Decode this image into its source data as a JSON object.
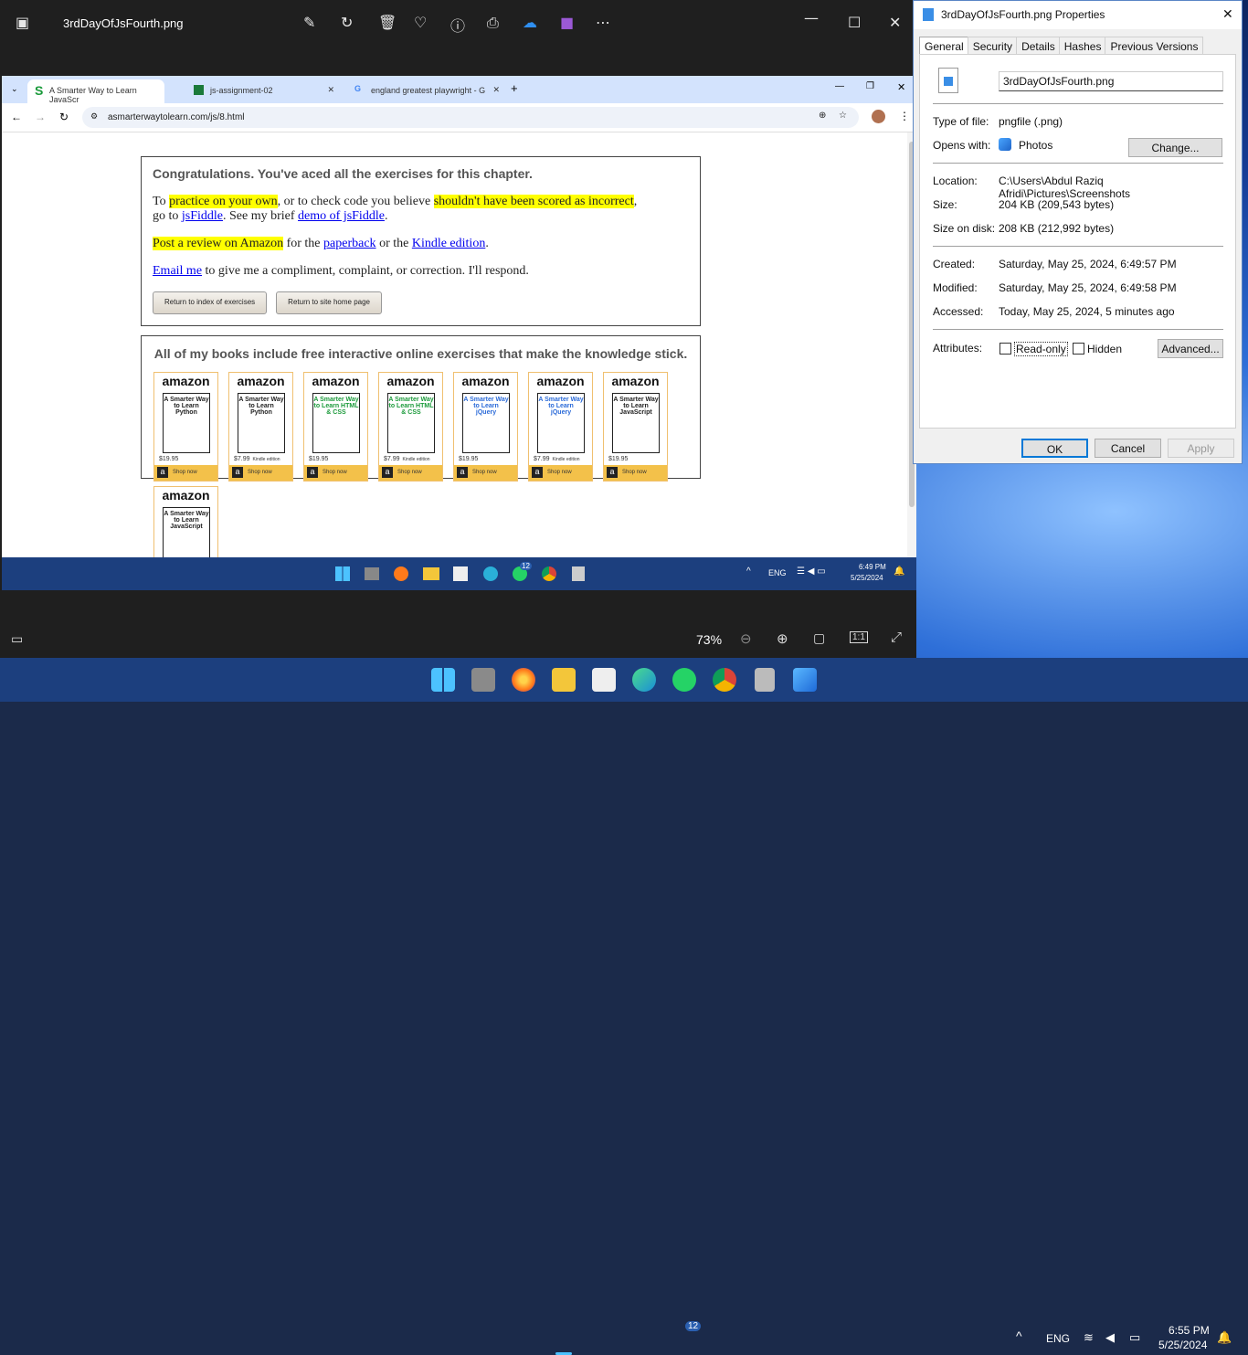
{
  "photos": {
    "filename": "3rdDayOfJsFourth.png",
    "zoom": "73%"
  },
  "browser": {
    "tabs": [
      {
        "label": "A Smarter Way to Learn JavaScr"
      },
      {
        "label": "js-assignment-02"
      },
      {
        "label": "england greatest playwright - G"
      }
    ],
    "url": "asmarterwaytolearn.com/js/8.html"
  },
  "page": {
    "congrats": "Congratulations. You've aced all the exercises for this chapter.",
    "p1_a": "To ",
    "p1_hl1": "practice on your own",
    "p1_b": ", or to check code you believe ",
    "p1_hl2": "shouldn't have been scored as incorrect",
    "p1_c": ",",
    "p1_d": "go to ",
    "p1_jsfiddle": "jsFiddle",
    "p1_e": ". See my brief ",
    "p1_demo": "demo of jsFiddle",
    "p1_f": ".",
    "p2_hl": "Post a review on Amazon",
    "p2_a": " for the ",
    "p2_paperback": "paperback",
    "p2_b": " or the ",
    "p2_kindle": "Kindle edition",
    "p2_c": ".",
    "p3_email": "Email me",
    "p3_a": " to give me a compliment, complaint, or correction. I'll respond.",
    "btn_index": "Return to index of exercises",
    "btn_home": "Return to site home page",
    "books_heading": "All of my books include free interactive online exercises that make the knowledge stick.",
    "amazon": "amazon",
    "shop": "Shop now",
    "books": [
      {
        "title": "A Smarter Way to Learn Python",
        "price": "$19.95",
        "kindle": "",
        "color": "#222"
      },
      {
        "title": "A Smarter Way to Learn Python",
        "price": "$7.99",
        "kindle": "Kindle edition",
        "color": "#222"
      },
      {
        "title": "A Smarter Way to Learn HTML & CSS",
        "price": "$19.95",
        "kindle": "",
        "color": "#1a9a3a"
      },
      {
        "title": "A Smarter Way to Learn HTML & CSS",
        "price": "$7.99",
        "kindle": "Kindle edition",
        "color": "#1a9a3a"
      },
      {
        "title": "A Smarter Way to Learn jQuery",
        "price": "$19.95",
        "kindle": "",
        "color": "#2a6ad8"
      },
      {
        "title": "A Smarter Way to Learn jQuery",
        "price": "$7.99",
        "kindle": "Kindle edition",
        "color": "#2a6ad8"
      },
      {
        "title": "A Smarter Way to Learn JavaScript",
        "price": "$19.95",
        "kindle": "",
        "color": "#222"
      },
      {
        "title": "A Smarter Way to Learn JavaScript",
        "price": "",
        "kindle": "",
        "color": "#222"
      }
    ]
  },
  "inner_taskbar": {
    "lang": "ENG",
    "time": "6:49 PM",
    "date": "5/25/2024",
    "whatsapp_badge": "12"
  },
  "props": {
    "title": "3rdDayOfJsFourth.png Properties",
    "tabs": [
      "General",
      "Security",
      "Details",
      "Hashes",
      "Previous Versions"
    ],
    "filename": "3rdDayOfJsFourth.png",
    "type_label": "Type of file:",
    "type_value": "pngfile (.png)",
    "opens_label": "Opens with:",
    "opens_value": "Photos",
    "change": "Change...",
    "location_label": "Location:",
    "location_value": "C:\\Users\\Abdul Raziq Afridi\\Pictures\\Screenshots",
    "size_label": "Size:",
    "size_value": "204 KB (209,543 bytes)",
    "disk_label": "Size on disk:",
    "disk_value": "208 KB (212,992 bytes)",
    "created_label": "Created:",
    "created_value": "Saturday, May 25, 2024, 6:49:57 PM",
    "modified_label": "Modified:",
    "modified_value": "Saturday, May 25, 2024, 6:49:58 PM",
    "accessed_label": "Accessed:",
    "accessed_value": "Today, May 25, 2024, 5 minutes ago",
    "attr_label": "Attributes:",
    "readonly": "Read-only",
    "hidden": "Hidden",
    "advanced": "Advanced...",
    "ok": "OK",
    "cancel": "Cancel",
    "apply": "Apply"
  },
  "taskbar": {
    "lang": "ENG",
    "time": "6:55 PM",
    "date": "5/25/2024",
    "whatsapp_badge": "12"
  }
}
